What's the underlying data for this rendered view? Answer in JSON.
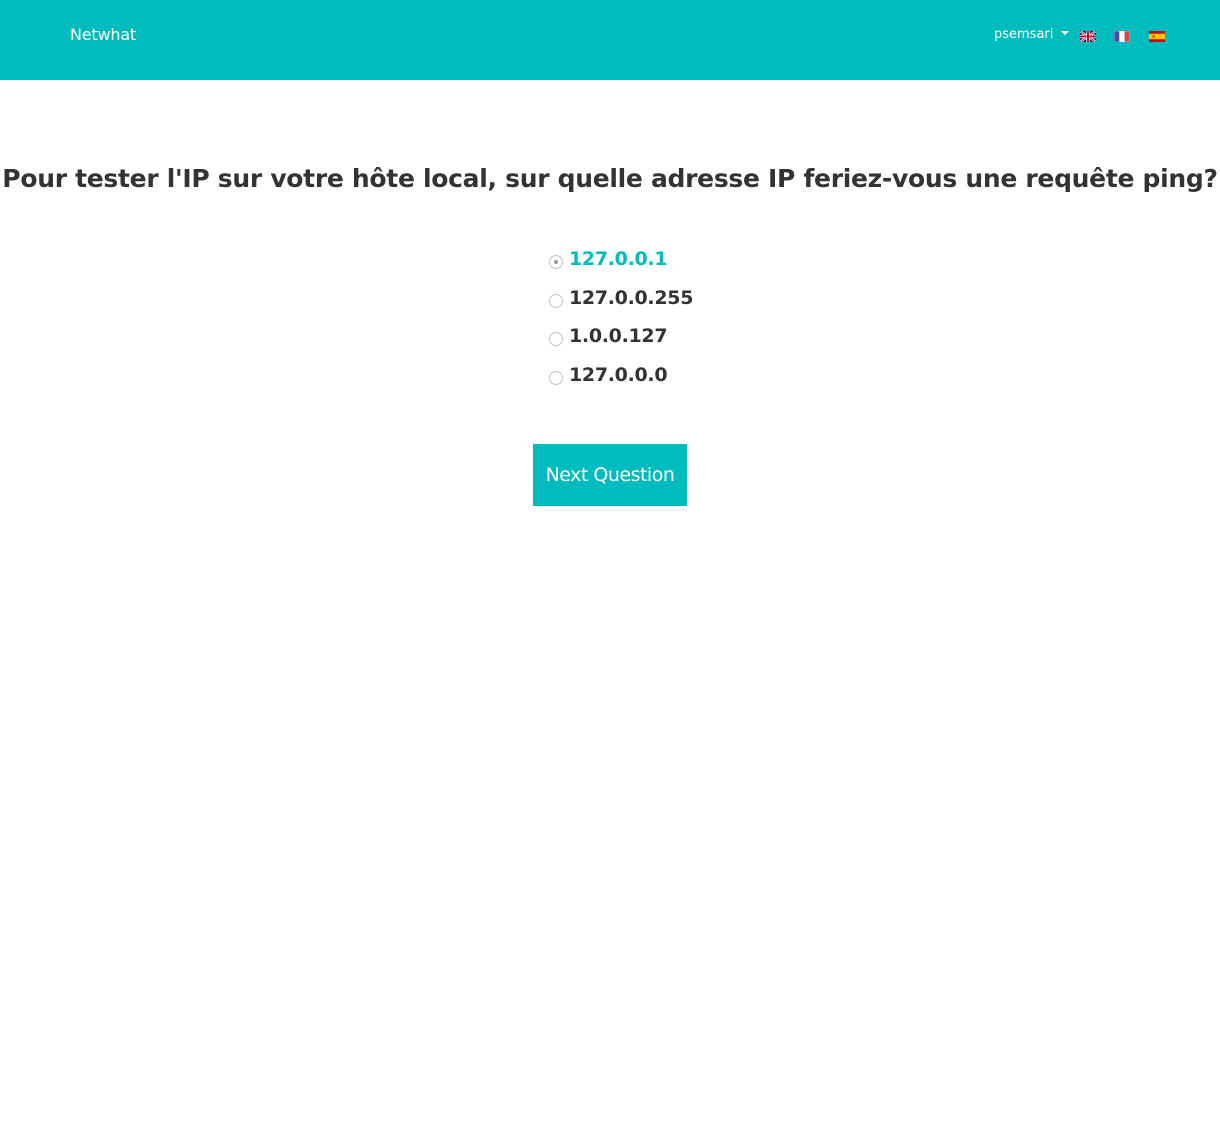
{
  "navbar": {
    "brand": "Netwhat",
    "user": "psemsari",
    "color": "#00bcbc",
    "languages": [
      {
        "code": "en",
        "icon": "uk-flag-icon"
      },
      {
        "code": "fr",
        "icon": "france-flag-icon"
      },
      {
        "code": "es",
        "icon": "spain-flag-icon"
      }
    ]
  },
  "quiz": {
    "question": "Pour tester l'IP sur votre hôte local, sur quelle adresse IP feriez-vous une requête ping?",
    "answers": [
      {
        "label": "127.0.0.1",
        "selected": true
      },
      {
        "label": "127.0.0.255",
        "selected": false
      },
      {
        "label": "1.0.0.127",
        "selected": false
      },
      {
        "label": "127.0.0.0",
        "selected": false
      }
    ],
    "selected_color": "#00bcbc",
    "next_label": "Next Question"
  }
}
